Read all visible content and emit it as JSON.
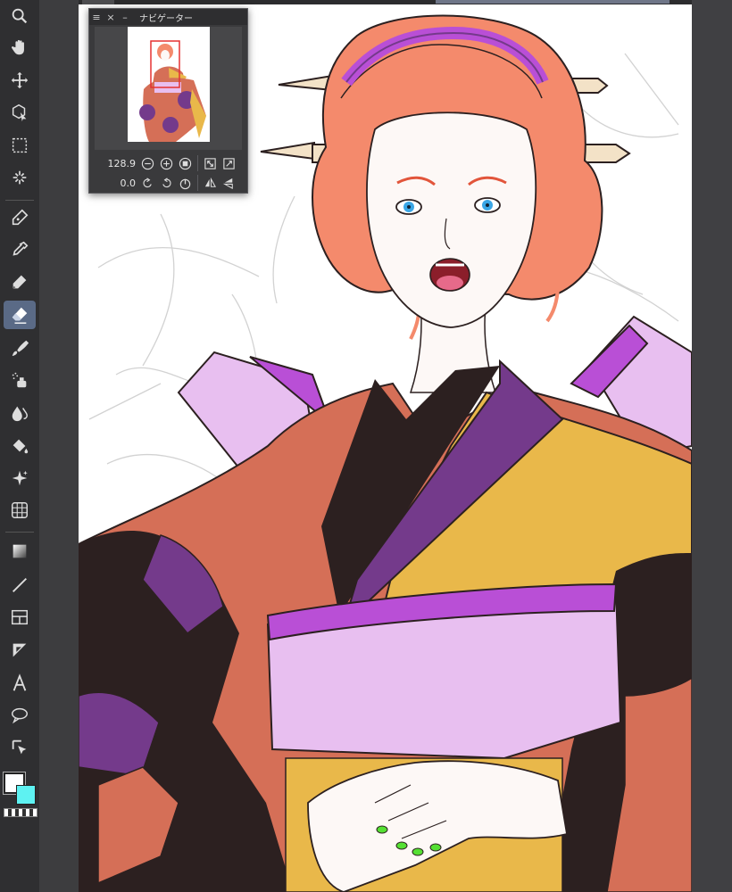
{
  "window": {
    "title": "ナビゲーター"
  },
  "navigator": {
    "title": "ナビゲーター",
    "zoom_value": "128.9",
    "rotation_value": "0.0",
    "buttons": [
      "zoom-out",
      "zoom-in",
      "fit-window",
      "rotate-left",
      "rotate-right",
      "reset-rotation",
      "fit-screen",
      "actual-size",
      "flip-horizontal",
      "flip-vertical"
    ]
  },
  "toolbar": {
    "tools": [
      "zoom",
      "hand",
      "move",
      "object",
      "selection",
      "auto-select",
      "pen",
      "eyedropper",
      "pencil",
      "eraser",
      "brush",
      "airbrush",
      "blend",
      "fill",
      "decoration",
      "figure-mesh",
      "gradient",
      "line",
      "frame",
      "ruler",
      "text",
      "balloon",
      "correct-line"
    ],
    "active_tool": "eraser"
  },
  "subtools": [
    "tool-property",
    "sub-view",
    "layer-property",
    "animation",
    "color-mix",
    "color-set",
    "layer",
    "material",
    "history",
    "auto-action"
  ],
  "colors": {
    "main": "#ffffff",
    "sub": "#5ef2f2",
    "accent_active": "#5a6a86"
  },
  "canvas": {
    "palette": {
      "hair": "#f48a6c",
      "skin": "#fdf8f6",
      "orange_kimono": "#d56f57",
      "mustard": "#e9b84a",
      "purple": "#743a8b",
      "lavender": "#e8bff0",
      "violet_band": "#b94fd6",
      "dark": "#2c2020",
      "nails": "#55e033",
      "eyes": "#3aa6e6"
    }
  }
}
